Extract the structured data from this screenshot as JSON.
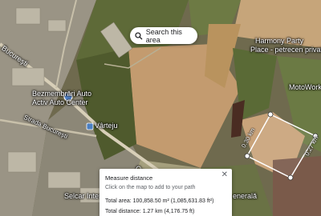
{
  "search": {
    "label": "Search this area"
  },
  "places": {
    "bucuresti": "Bucureşti",
    "bezmembrari_1": "Bezmembrări Auto",
    "bezmembrari_2": "Activ Auto Center",
    "strada_bucuresti": "Strada București",
    "varteju": "Vârteju",
    "harmony_1": "Harmony Party",
    "harmony_2": "Place - petrecen private...",
    "motoworks": "MotoWorks",
    "selcar": "Selcar Inter",
    "generala": "enerală",
    "road_label": "Ce"
  },
  "measure": {
    "title": "Measure distance",
    "hint": "Click on the map to add to your path",
    "total_area": "Total area: 100,858.50 m² (1,085,631.83 ft²)",
    "total_distance": "Total distance: 1.27 km (4,176.75 ft)",
    "segment_left": "0.30 km",
    "segment_right": "0.27 km",
    "close_icon": "close-icon"
  },
  "colors": {
    "field_light": "#c9a27a",
    "field_green": "#6b7a3c",
    "road": "#d8cfb8",
    "measure_line": "#ffffff"
  }
}
